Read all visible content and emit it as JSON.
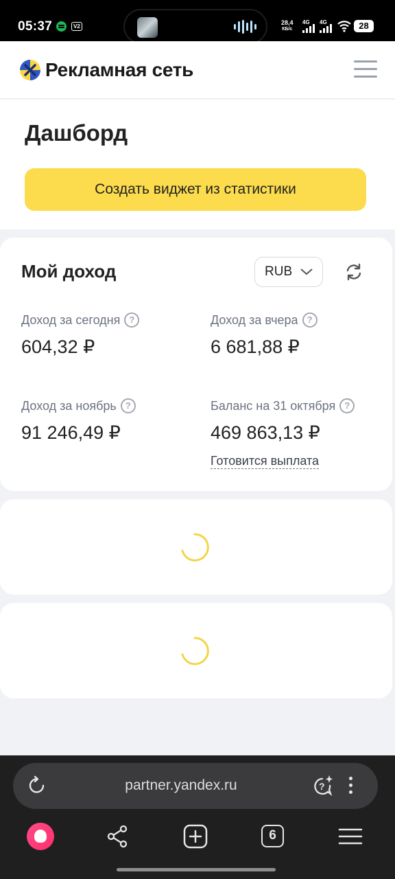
{
  "status_bar": {
    "time": "05:37",
    "v2_badge": "V2",
    "net_speed_value": "28,4",
    "net_speed_unit": "КБ/с",
    "sim1": "4G",
    "sim2": "4G",
    "battery": "28"
  },
  "header": {
    "brand": "Рекламная сеть",
    "logo_icon": "yandex-advertising-network-logo",
    "menu_icon": "hamburger-menu-icon"
  },
  "dashboard": {
    "title": "Дашборд",
    "create_widget_label": "Создать виджет из статистики"
  },
  "income": {
    "title": "Мой доход",
    "currency": "RUB",
    "refresh_icon": "refresh-icon",
    "metrics": [
      {
        "label": "Доход за сегодня",
        "value": "604,32 ₽"
      },
      {
        "label": "Доход за вчера",
        "value": "6 681,88 ₽"
      },
      {
        "label": "Доход за ноябрь",
        "value": "91 246,49 ₽"
      },
      {
        "label": "Баланс на 31 октября",
        "value": "469 863,13 ₽"
      }
    ],
    "help_glyph": "?",
    "payout_status": "Готовится выплата"
  },
  "browser": {
    "url": "partner.yandex.ru",
    "tabs_count": "6",
    "icons": [
      "reload-icon",
      "ai-help-icon",
      "more-icon",
      "alice-icon",
      "share-icon",
      "new-tab-icon",
      "tabs-icon",
      "menu-icon"
    ]
  },
  "colors": {
    "accent_yellow": "#fcdc4d",
    "spinner": "#f2d548",
    "page_bg": "#f1f2f5"
  }
}
